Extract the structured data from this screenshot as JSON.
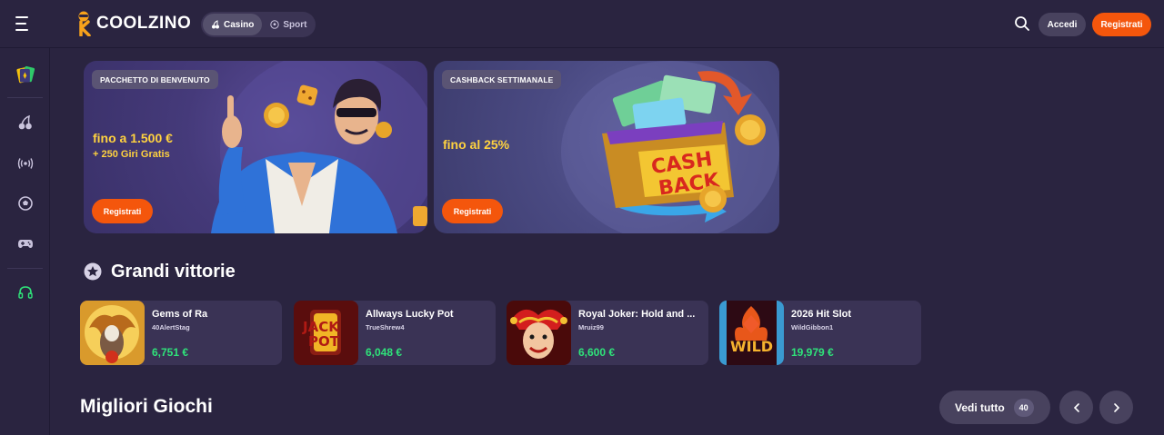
{
  "header": {
    "logo_text": "COOLZINO",
    "modes": [
      {
        "label": "Casino",
        "icon": "cherry-icon",
        "active": true
      },
      {
        "label": "Sport",
        "icon": "soccer-ball-icon",
        "active": false
      }
    ],
    "login_label": "Accedi",
    "register_label": "Registrati"
  },
  "sidebar": {
    "items": [
      {
        "name": "promotions",
        "icon": "cards-icon"
      },
      {
        "name": "casino",
        "icon": "cherry-icon"
      },
      {
        "name": "live",
        "icon": "broadcast-icon"
      },
      {
        "name": "sport",
        "icon": "soccer-ball-icon"
      },
      {
        "name": "games",
        "icon": "gamepad-icon"
      },
      {
        "name": "support",
        "icon": "headset-icon"
      }
    ]
  },
  "promos": [
    {
      "tag": "PACCHETTO DI BENVENUTO",
      "line1": "fino a 1.500 €",
      "line2": "+ 250 Giri Gratis",
      "cta": "Registrati"
    },
    {
      "tag": "CASHBACK SETTIMANALE",
      "line1": "fino al 25%",
      "line2": "",
      "cta": "Registrati",
      "art_text": [
        "CASH",
        "BACK"
      ]
    }
  ],
  "big_wins": {
    "title": "Grandi vittorie",
    "items": [
      {
        "game": "Gems of Ra",
        "user": "40AlertStag",
        "amount": "6,751 €"
      },
      {
        "game": "Allways Lucky Pot",
        "user": "TrueShrew4",
        "amount": "6,048 €",
        "thumb_text": [
          "JACK",
          "POT"
        ]
      },
      {
        "game": "Royal Joker: Hold and ...",
        "user": "Mruiz99",
        "amount": "6,600 €"
      },
      {
        "game": "2026 Hit Slot",
        "user": "WildGibbon1",
        "amount": "19,979 €",
        "thumb_text": [
          "WILD"
        ]
      }
    ]
  },
  "best_games": {
    "title": "Migliori Giochi",
    "see_all_label": "Vedi tutto",
    "count": "40"
  },
  "colors": {
    "background": "#2a2440",
    "accent": "#f4560c",
    "win_green": "#2fe37a",
    "promo_yellow": "#ffd23f"
  }
}
